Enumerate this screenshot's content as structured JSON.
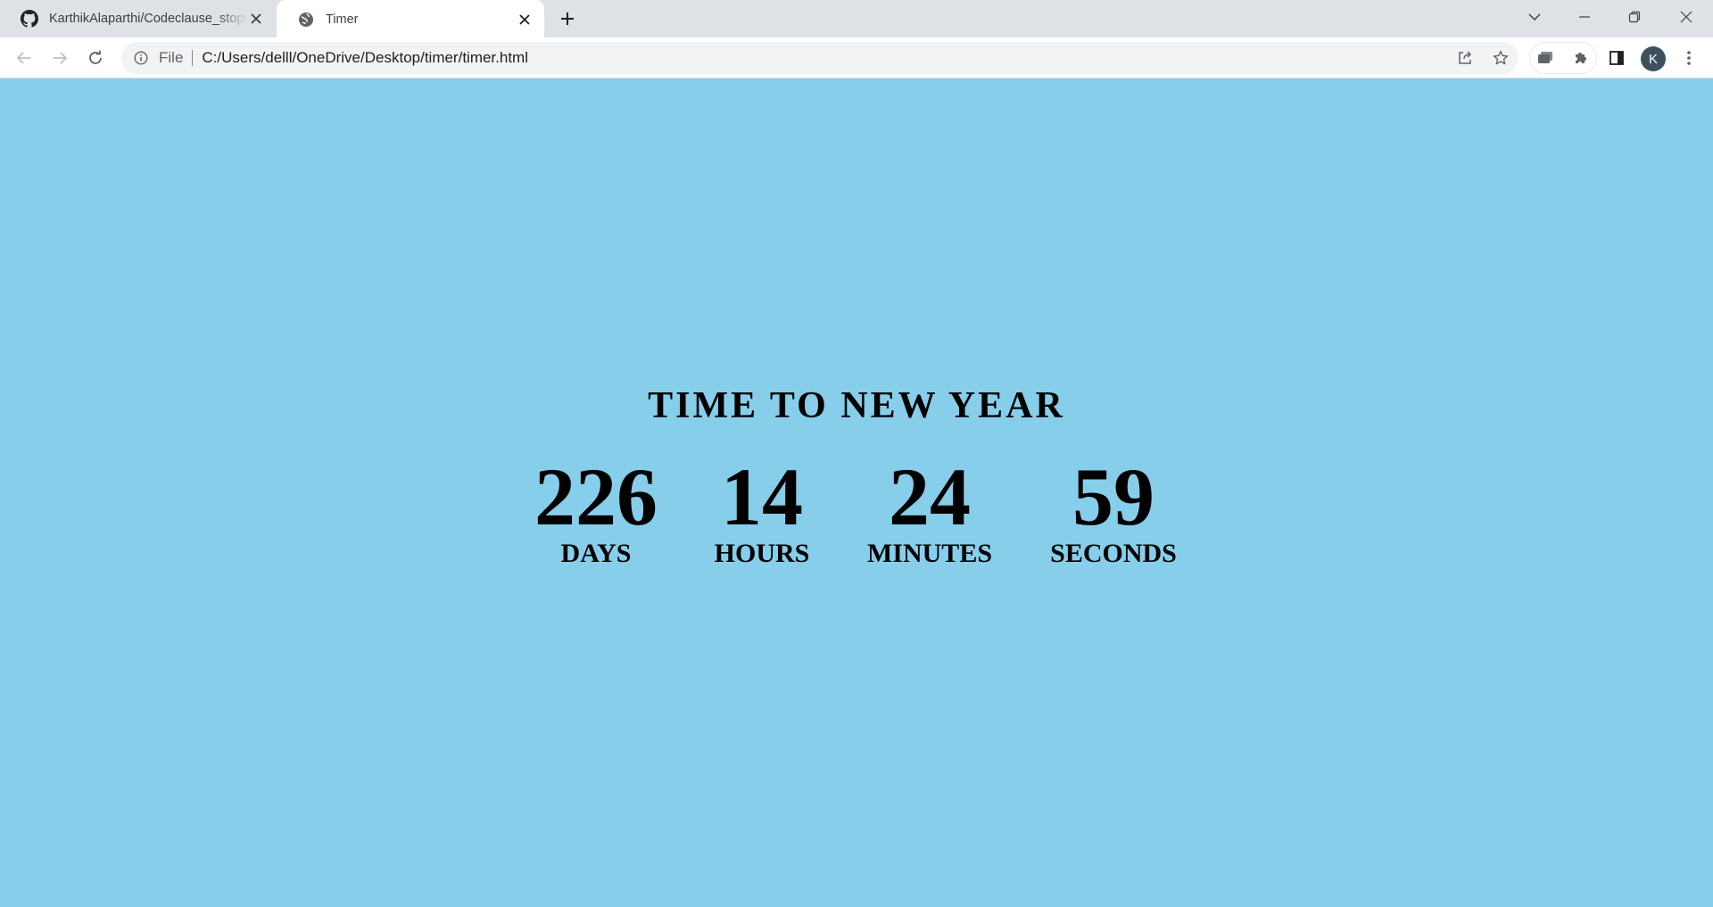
{
  "browser": {
    "tabs": [
      {
        "title": "KarthikAlaparthi/Codeclause_stopwatch",
        "icon": "github-icon",
        "active": false
      },
      {
        "title": "Timer",
        "icon": "globe-icon",
        "active": true
      }
    ],
    "omnibox": {
      "scheme_label": "File",
      "url": "C:/Users/delll/OneDrive/Desktop/timer/timer.html"
    },
    "profile_initial": "K"
  },
  "page": {
    "heading": "TIME TO NEW YEAR",
    "countdown": [
      {
        "value": "226",
        "label": "DAYS"
      },
      {
        "value": "14",
        "label": "HOURS"
      },
      {
        "value": "24",
        "label": "MINUTES"
      },
      {
        "value": "59",
        "label": "SECONDS"
      }
    ]
  },
  "colors": {
    "page_background": "#87CEEB",
    "text": "#000000"
  }
}
